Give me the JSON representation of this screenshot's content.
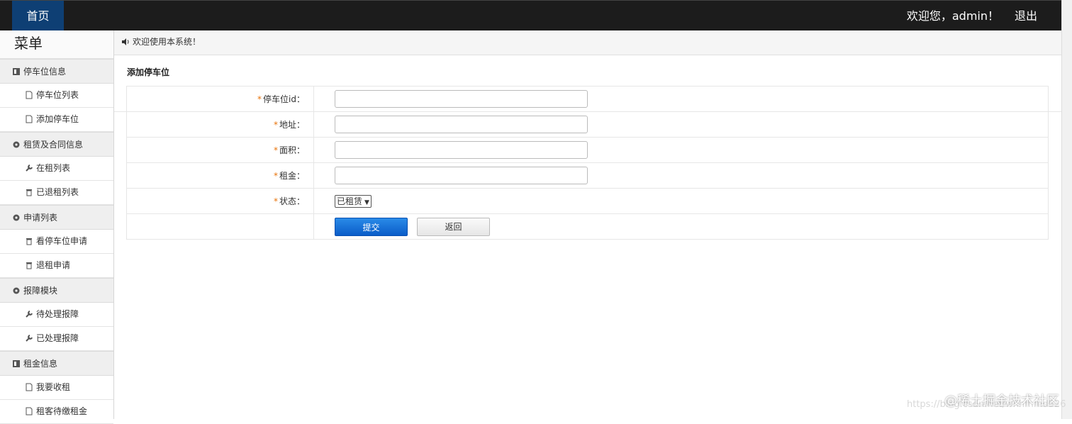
{
  "topbar": {
    "home_label": "首页",
    "welcome": "欢迎您，admin！",
    "logout": "退出"
  },
  "sidebar": {
    "title": "菜单",
    "groups": [
      {
        "label": "停车位信息",
        "icon": "book-icon",
        "items": [
          {
            "label": "停车位列表",
            "icon": "file-icon"
          },
          {
            "label": "添加停车位",
            "icon": "file-icon"
          }
        ]
      },
      {
        "label": "租赁及合同信息",
        "icon": "gear-icon",
        "items": [
          {
            "label": "在租列表",
            "icon": "wrench-icon"
          },
          {
            "label": "已退租列表",
            "icon": "trash-icon"
          }
        ]
      },
      {
        "label": "申请列表",
        "icon": "gear-icon",
        "items": [
          {
            "label": "看停车位申请",
            "icon": "trash-icon"
          },
          {
            "label": "退租申请",
            "icon": "trash-icon"
          }
        ]
      },
      {
        "label": "报障模块",
        "icon": "gear-icon",
        "items": [
          {
            "label": "待处理报障",
            "icon": "wrench-icon"
          },
          {
            "label": "已处理报障",
            "icon": "wrench-icon"
          }
        ]
      },
      {
        "label": "租金信息",
        "icon": "book-icon",
        "items": [
          {
            "label": "我要收租",
            "icon": "file-icon"
          },
          {
            "label": "租客待缴租金",
            "icon": "file-icon"
          }
        ]
      }
    ]
  },
  "notice": {
    "text": "欢迎使用本系统！",
    "icon": "volume-icon"
  },
  "form": {
    "title": "添加停车位",
    "fields": [
      {
        "label": "停车位id：",
        "value": ""
      },
      {
        "label": "地址：",
        "value": ""
      },
      {
        "label": "面积：",
        "value": ""
      },
      {
        "label": "租金：",
        "value": ""
      }
    ],
    "status": {
      "label": "状态：",
      "selected": "已租赁"
    },
    "submit_label": "提交",
    "back_label": "返回",
    "required_marker": "*"
  },
  "watermark": {
    "text": "@稀土掘金技术社区",
    "url": "https://blog.csdn.net/whhmmd526"
  },
  "colors": {
    "topbar": "#1c1c1c",
    "home_tab": "#0e3f74",
    "submit": "#0a5cc8",
    "required": "#e8740c"
  }
}
